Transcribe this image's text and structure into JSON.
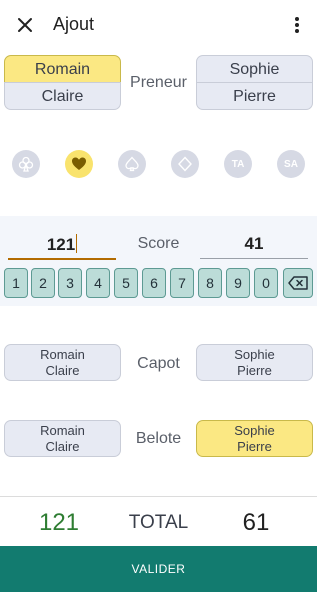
{
  "appbar": {
    "title": "Ajout",
    "close_icon": "close-icon",
    "more_icon": "more-vert-icon"
  },
  "taker": {
    "label": "Preneur",
    "team_left": [
      {
        "name": "Romain",
        "selected": true
      },
      {
        "name": "Claire",
        "selected": false
      }
    ],
    "team_right": [
      {
        "name": "Sophie",
        "selected": false
      },
      {
        "name": "Pierre",
        "selected": false
      }
    ]
  },
  "trumps": [
    {
      "icon": "clubs-icon",
      "text": "",
      "selected": false
    },
    {
      "icon": "hearts-icon",
      "text": "",
      "selected": true
    },
    {
      "icon": "spades-icon",
      "text": "",
      "selected": false
    },
    {
      "icon": "diamonds-icon",
      "text": "",
      "selected": false
    },
    {
      "icon": "all-trump-icon",
      "text": "TA",
      "selected": false
    },
    {
      "icon": "no-trump-icon",
      "text": "SA",
      "selected": false
    }
  ],
  "score": {
    "label": "Score",
    "left_value": "121",
    "right_value": "41"
  },
  "keypad": {
    "keys": [
      "1",
      "2",
      "3",
      "4",
      "5",
      "6",
      "7",
      "8",
      "9",
      "0"
    ],
    "backspace_icon": "backspace-icon"
  },
  "capot": {
    "label": "Capot",
    "left": "Romain\nClaire",
    "right": "Sophie\nPierre",
    "selected": "none"
  },
  "belote": {
    "label": "Belote",
    "left": "Romain\nClaire",
    "right": "Sophie\nPierre",
    "selected": "right"
  },
  "totals": {
    "label": "TOTAL",
    "left": "121",
    "right": "61",
    "left_color": "#2e7d32"
  },
  "actions": {
    "validate_label": "VALIDER"
  },
  "colors": {
    "accent": "#127b6f",
    "selected": "#fbe883",
    "key": "#bcdcd8",
    "caret": "#b26b00"
  }
}
